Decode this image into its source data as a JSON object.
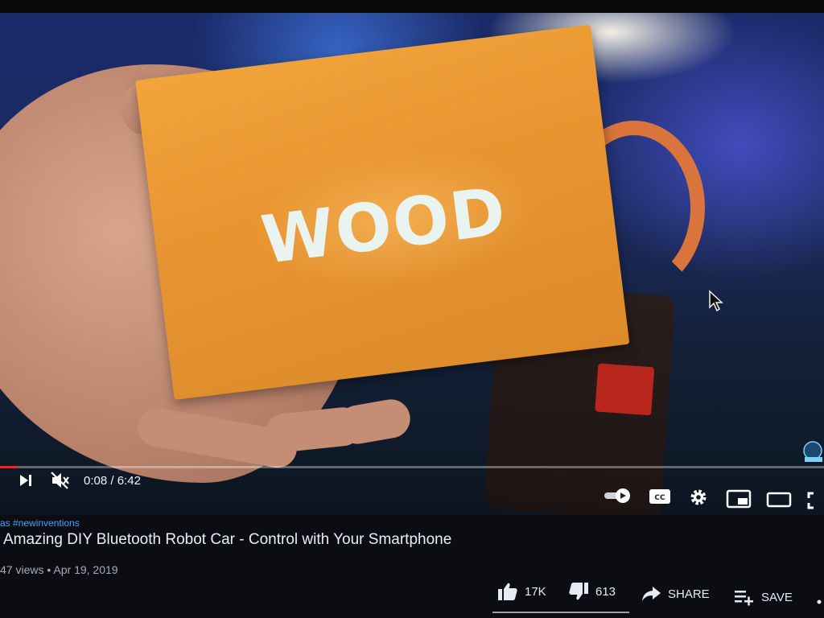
{
  "video": {
    "card_text": "WOOD",
    "progress_fraction": 0.021
  },
  "player": {
    "current_time": "0:08",
    "duration": "6:42",
    "separator": " / ",
    "icons": [
      "next-icon",
      "mute-icon",
      "autoplay-toggle-icon",
      "captions-icon",
      "settings-icon",
      "miniplayer-icon",
      "theater-icon",
      "fullscreen-icon"
    ]
  },
  "info": {
    "hashtag": "as #newinventions",
    "title": "Amazing DIY Bluetooth Robot Car - Control with Your Smartphone",
    "views": "47 views",
    "dot": " • ",
    "date": "Apr 19, 2019"
  },
  "actions": {
    "like_count": "17K",
    "dislike_count": "613",
    "share_label": "SHARE",
    "save_label": "SAVE"
  },
  "colors": {
    "progress": "#ff1f1f",
    "hashtag": "#3ea6ff",
    "card": "#e79430"
  }
}
